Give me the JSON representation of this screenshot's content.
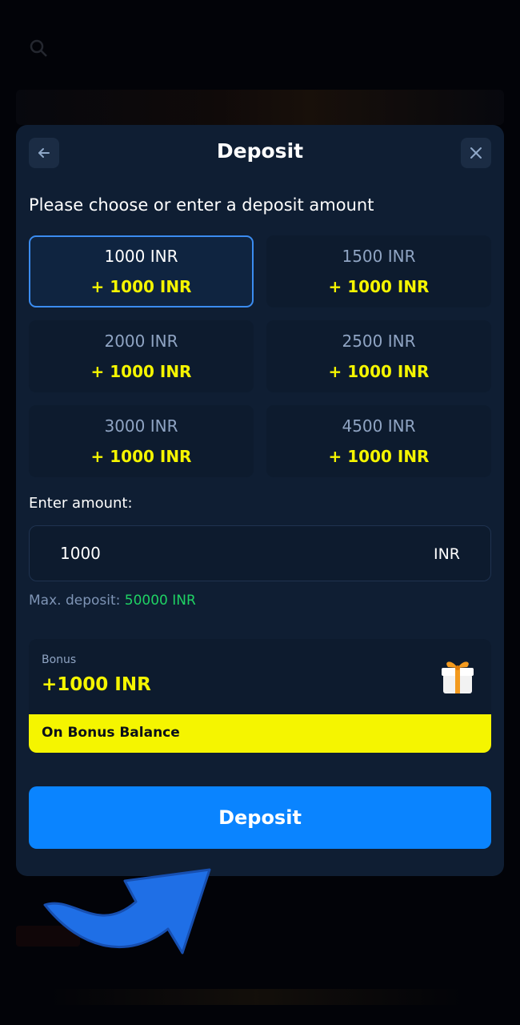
{
  "modal": {
    "title": "Deposit",
    "subtitle": "Please choose or enter a deposit amount",
    "back_icon": "arrow-left-icon",
    "close_icon": "close-icon"
  },
  "amount_options": [
    {
      "amount": "1000 INR",
      "bonus": "+ 1000 INR",
      "selected": true
    },
    {
      "amount": "1500 INR",
      "bonus": "+ 1000 INR",
      "selected": false
    },
    {
      "amount": "2000 INR",
      "bonus": "+ 1000 INR",
      "selected": false
    },
    {
      "amount": "2500 INR",
      "bonus": "+ 1000 INR",
      "selected": false
    },
    {
      "amount": "3000 INR",
      "bonus": "+ 1000 INR",
      "selected": false
    },
    {
      "amount": "4500 INR",
      "bonus": "+ 1000 INR",
      "selected": false
    }
  ],
  "enter_amount": {
    "label": "Enter amount:",
    "value": "1000",
    "currency": "INR"
  },
  "max_deposit": {
    "label": "Max. deposit:",
    "value": "50000 INR"
  },
  "bonus": {
    "label": "Bonus",
    "value": "+1000 INR",
    "bar_text": "On Bonus Balance",
    "icon": "gift-icon"
  },
  "deposit_button": {
    "label": "Deposit"
  },
  "colors": {
    "accent_blue": "#0a84ff",
    "bonus_yellow": "#f5f500",
    "max_green": "#1fd264",
    "modal_bg": "#0f1e33"
  }
}
